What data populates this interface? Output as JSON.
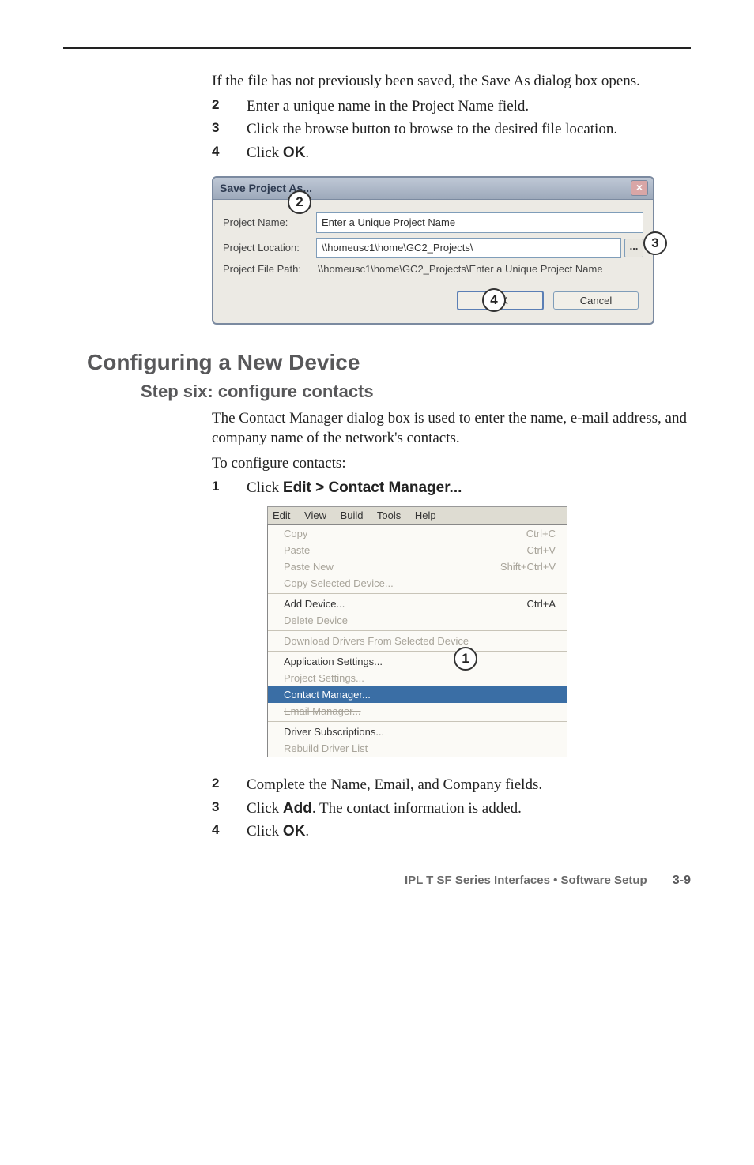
{
  "intro": {
    "para": "If the file has not previously been saved, the Save As dialog box opens.",
    "steps": [
      "Enter a unique name in the Project Name field.",
      "Click the browse button to browse to the desired file location.",
      "Click "
    ],
    "step_numbers": [
      "2",
      "3",
      "4"
    ],
    "ok": "OK",
    "dot": "."
  },
  "dialog": {
    "title": "Save Project As...",
    "close": "×",
    "labels": {
      "name": "Project Name:",
      "location": "Project Location:",
      "path": "Project File Path:"
    },
    "values": {
      "name": "Enter a Unique Project Name",
      "location": "\\\\homeusc1\\home\\GC2_Projects\\",
      "path": "\\\\homeusc1\\home\\GC2_Projects\\Enter a Unique Project Name"
    },
    "browse": "...",
    "ok": "OK",
    "cancel": "Cancel",
    "callouts": {
      "c2": "2",
      "c3": "3",
      "c4": "4"
    }
  },
  "section": {
    "h2": "Configuring a New Device",
    "h3": "Step six: configure contacts",
    "para1": "The Contact Manager dialog box is used to enter the name, e-mail address, and company name of the network's contacts.",
    "para2": "To configure contacts:",
    "step1_num": "1",
    "step1_pre": "Click ",
    "step1_bold": "Edit > Contact Manager...",
    "callout1": "1"
  },
  "menu": {
    "bar": [
      "Edit",
      "View",
      "Build",
      "Tools",
      "Help"
    ],
    "items": [
      {
        "label": "Copy",
        "accel": "Ctrl+C",
        "disabled": true
      },
      {
        "label": "Paste",
        "accel": "Ctrl+V",
        "disabled": true
      },
      {
        "label": "Paste New",
        "accel": "Shift+Ctrl+V",
        "disabled": true
      },
      {
        "label": "Copy Selected Device...",
        "accel": "",
        "disabled": true
      }
    ],
    "items2": [
      {
        "label": "Add Device...",
        "accel": "Ctrl+A",
        "disabled": false
      },
      {
        "label": "Delete Device",
        "accel": "",
        "disabled": true
      }
    ],
    "items3": [
      {
        "label": "Download Drivers From Selected Device",
        "accel": "",
        "disabled": true
      }
    ],
    "items4": [
      {
        "label": "Application Settings...",
        "accel": "",
        "disabled": false
      },
      {
        "label": "Project Settings...",
        "accel": "",
        "disabled": true
      },
      {
        "label": "Contact Manager...",
        "accel": "",
        "disabled": false,
        "highlight": true
      },
      {
        "label": "Email Manager...",
        "accel": "",
        "disabled": true
      }
    ],
    "items5": [
      {
        "label": "Driver Subscriptions...",
        "accel": "",
        "disabled": false
      },
      {
        "label": "Rebuild Driver List",
        "accel": "",
        "disabled": true
      }
    ]
  },
  "post": {
    "steps": [
      "Complete the Name, Email, and Company fields.",
      "Click ",
      "Click "
    ],
    "step_numbers": [
      "2",
      "3",
      "4"
    ],
    "add": "Add",
    "add_tail": ".  The contact information is added.",
    "ok": "OK",
    "dot": "."
  },
  "footer": {
    "text": "IPL T SF Series Interfaces • Software Setup",
    "page": "3-9"
  }
}
